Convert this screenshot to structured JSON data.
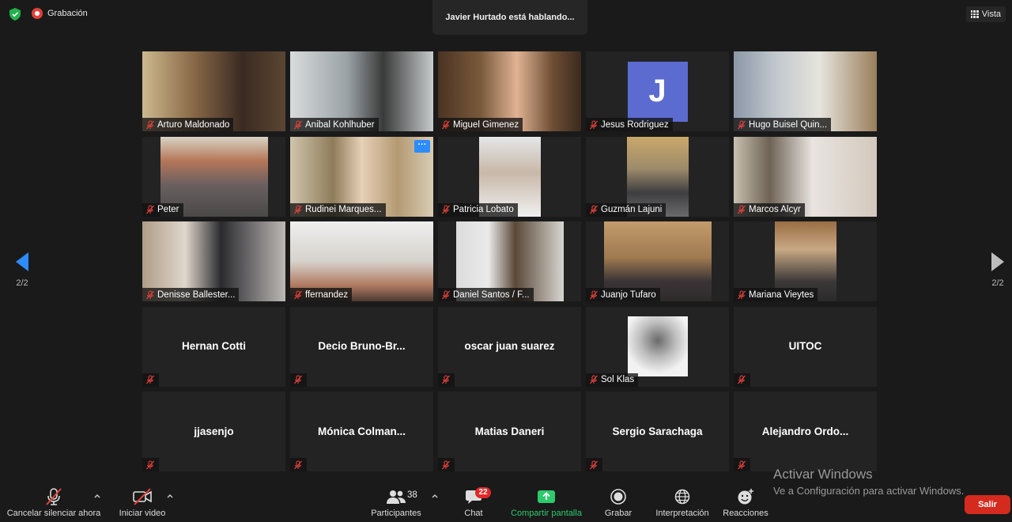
{
  "top_bar": {
    "recording_label": "Grabación",
    "speaking_banner": "Javier Hurtado está hablando...",
    "view_label": "Vista"
  },
  "pagination": {
    "left": "2/2",
    "right": "2/2"
  },
  "participants": [
    {
      "name": "Arturo Maldonado",
      "kind": "video"
    },
    {
      "name": "Anibal Kohlhuber",
      "kind": "video"
    },
    {
      "name": "Miguel Gimenez",
      "kind": "video"
    },
    {
      "name": "Jesus Rodriguez",
      "kind": "avatar",
      "initial": "J"
    },
    {
      "name": "Hugo Buisel Quin...",
      "kind": "video"
    },
    {
      "name": "Peter",
      "kind": "video"
    },
    {
      "name": "Rudinei Marques...",
      "kind": "video",
      "more": "···"
    },
    {
      "name": "Patricia Lobato",
      "kind": "video"
    },
    {
      "name": "Guzmán Lajuni",
      "kind": "video"
    },
    {
      "name": "Marcos Alcyr",
      "kind": "video"
    },
    {
      "name": "Denisse Ballester...",
      "kind": "video"
    },
    {
      "name": "ffernandez",
      "kind": "video"
    },
    {
      "name": "Daniel Santos / F...",
      "kind": "video"
    },
    {
      "name": "Juanjo Tufaro",
      "kind": "video"
    },
    {
      "name": "Mariana Vieytes",
      "kind": "video"
    },
    {
      "name": "Hernan Cotti",
      "kind": "name"
    },
    {
      "name": "Decio  Bruno-Br...",
      "kind": "name"
    },
    {
      "name": "oscar juan suarez",
      "kind": "name"
    },
    {
      "name": "Sol Klas",
      "kind": "photo"
    },
    {
      "name": "UITOC",
      "kind": "name"
    },
    {
      "name": "jjasenjo",
      "kind": "name"
    },
    {
      "name": "Mónica  Colman...",
      "kind": "name"
    },
    {
      "name": "Matias Daneri",
      "kind": "name"
    },
    {
      "name": "Sergio Sarachaga",
      "kind": "name"
    },
    {
      "name": "Alejandro  Ordo...",
      "kind": "name"
    }
  ],
  "toolbar": {
    "unmute": "Cancelar silenciar ahora",
    "start_video": "Iniciar video",
    "participants": "Participantes",
    "participants_count": "38",
    "chat": "Chat",
    "chat_badge": "22",
    "share_screen": "Compartir pantalla",
    "record": "Grabar",
    "interpretation": "Interpretación",
    "reactions": "Reacciones",
    "leave": "Salir"
  },
  "watermark": {
    "line1": "Activar Windows",
    "line2": "Ve a Configuración para activar Windows."
  },
  "colors": {
    "accent_blue": "#2d8cff",
    "leave_red": "#d52b1e",
    "share_green": "#2dc96d",
    "avatar_purple": "#5b6bd0",
    "mute_red": "#e0413a"
  }
}
